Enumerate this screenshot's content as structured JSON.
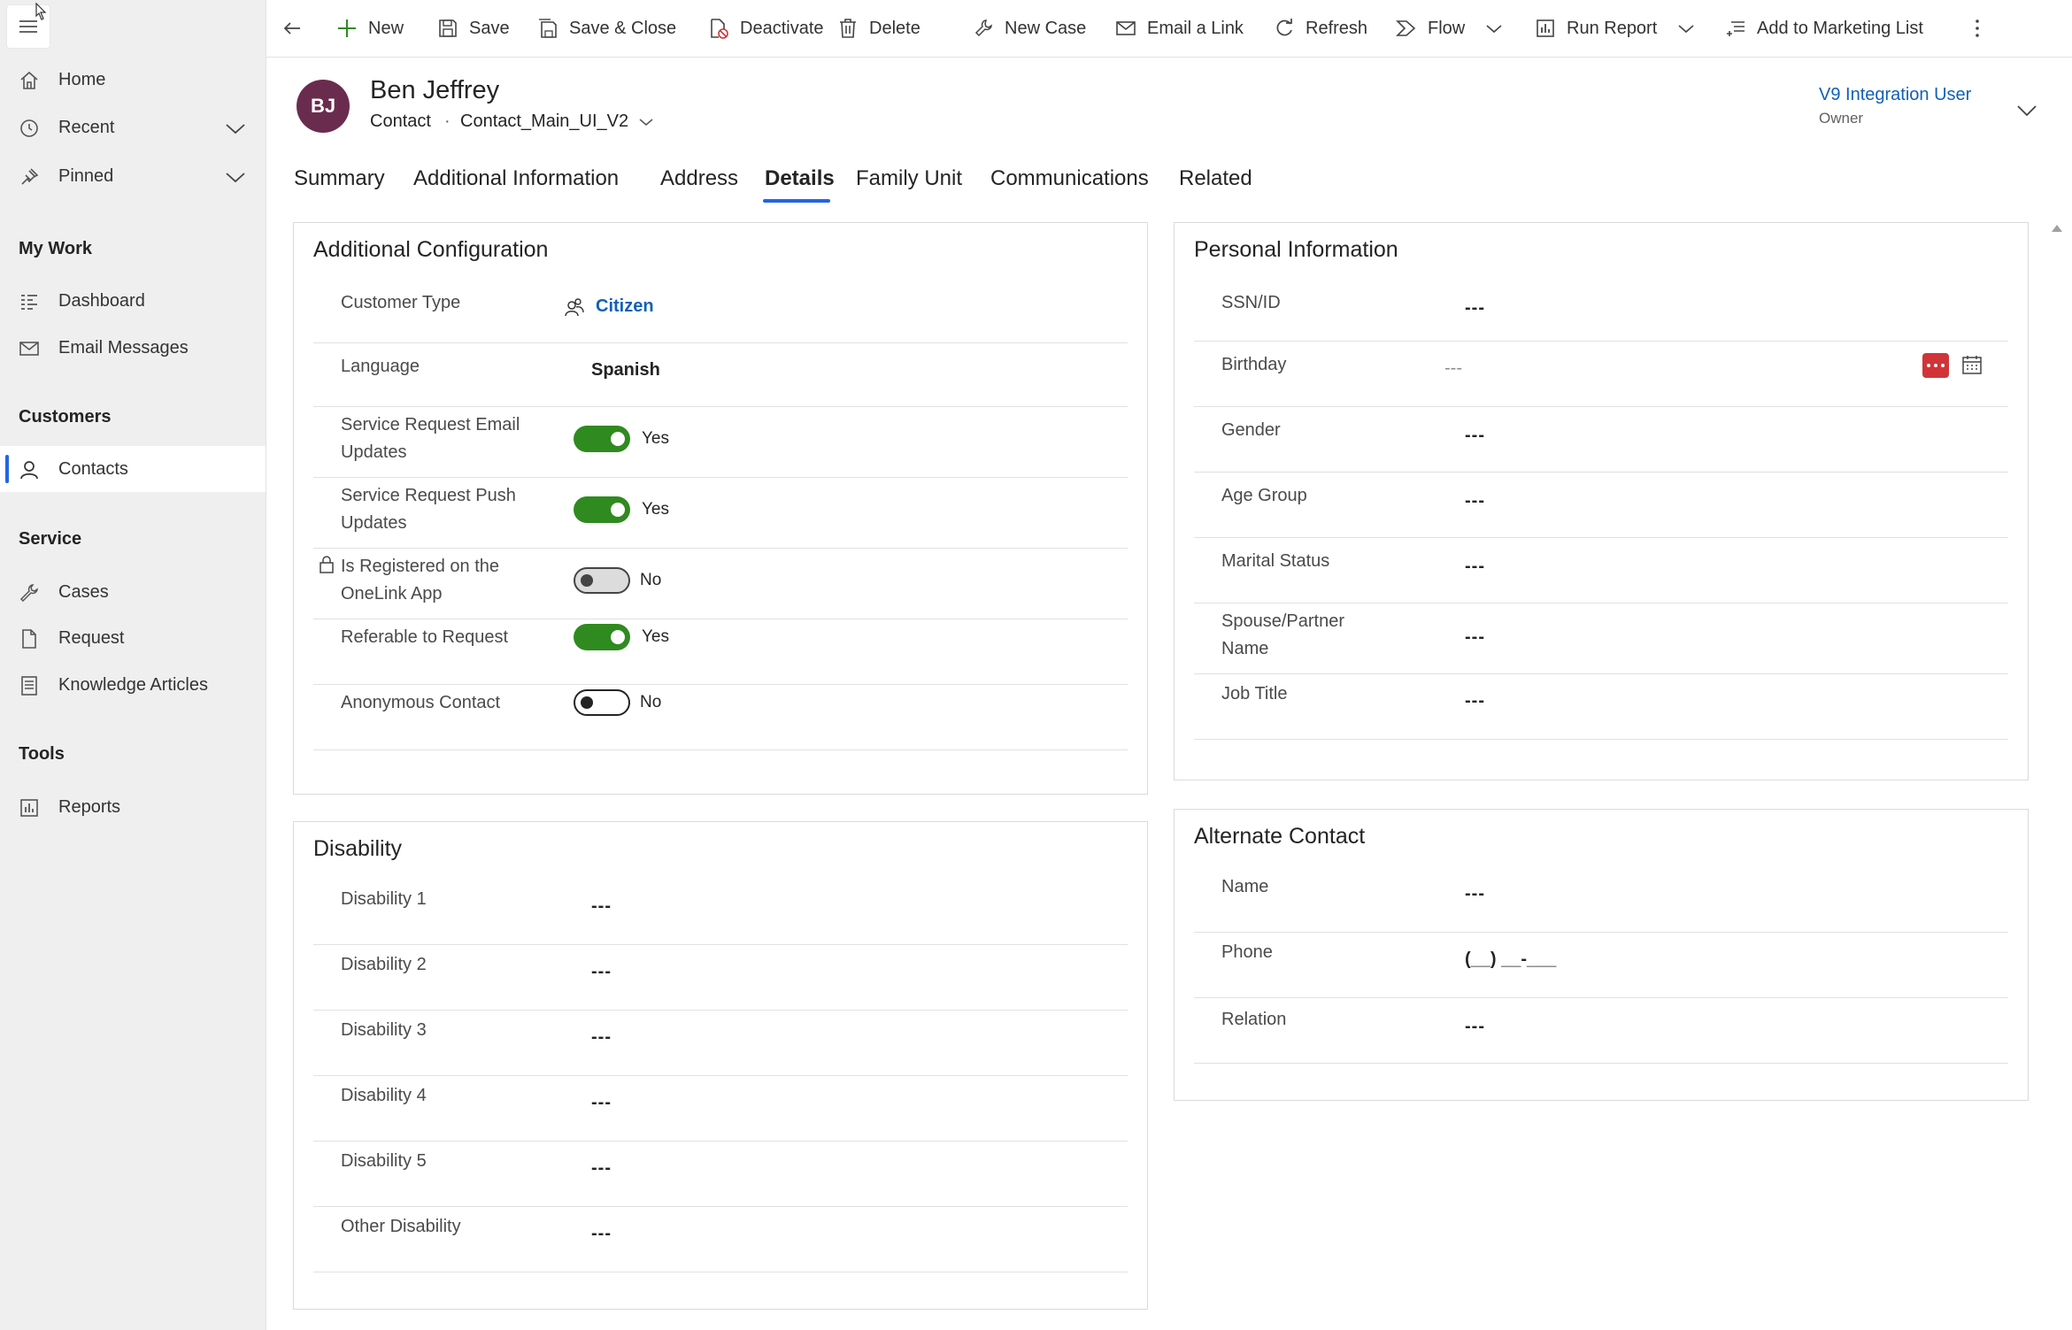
{
  "sidebar": {
    "items": [
      {
        "label": "Home",
        "icon": "home-icon"
      },
      {
        "label": "Recent",
        "icon": "clock-icon"
      },
      {
        "label": "Pinned",
        "icon": "pin-icon"
      },
      {
        "label": "Dashboard",
        "icon": "dashboard-icon"
      },
      {
        "label": "Email Messages",
        "icon": "mail-icon"
      },
      {
        "label": "Contacts",
        "icon": "person-icon"
      },
      {
        "label": "Cases",
        "icon": "wrench-icon"
      },
      {
        "label": "Request",
        "icon": "document-icon"
      },
      {
        "label": "Knowledge Articles",
        "icon": "book-icon"
      },
      {
        "label": "Reports",
        "icon": "report-icon"
      }
    ],
    "groups": [
      "My Work",
      "Customers",
      "Service",
      "Tools"
    ]
  },
  "commands": [
    {
      "label": "New",
      "icon": "plus-icon"
    },
    {
      "label": "Save",
      "icon": "save-icon"
    },
    {
      "label": "Save & Close",
      "icon": "save-close-icon"
    },
    {
      "label": "Deactivate",
      "icon": "deactivate-icon"
    },
    {
      "label": "Delete",
      "icon": "trash-icon"
    },
    {
      "label": "New Case",
      "icon": "new-case-icon"
    },
    {
      "label": "Email a Link",
      "icon": "email-link-icon"
    },
    {
      "label": "Refresh",
      "icon": "refresh-icon"
    },
    {
      "label": "Flow",
      "icon": "flow-icon"
    },
    {
      "label": "Run Report",
      "icon": "report-icon"
    },
    {
      "label": "Add to Marketing List",
      "icon": "add-list-icon"
    }
  ],
  "record": {
    "initials": "BJ",
    "name": "Ben Jeffrey",
    "entity": "Contact",
    "separator": "·",
    "form": "Contact_Main_UI_V2",
    "owner_name": "V9 Integration User",
    "owner_role": "Owner"
  },
  "tabs": [
    "Summary",
    "Additional Information",
    "Address",
    "Details",
    "Family Unit",
    "Communications",
    "Related"
  ],
  "active_tab": "Details",
  "sections": {
    "additional_configuration": {
      "title": "Additional Configuration",
      "customer_type_label": "Customer Type",
      "customer_type_value": "Citizen",
      "language_label": "Language",
      "language_value": "Spanish",
      "toggles": [
        {
          "label1": "Service Request Email",
          "label2": "Updates",
          "state": "Yes",
          "on": true
        },
        {
          "label1": "Service Request Push",
          "label2": "Updates",
          "state": "Yes",
          "on": true
        },
        {
          "label1": "Is Registered on the",
          "label2": "OneLink App",
          "state": "No",
          "on": false,
          "locked": true
        },
        {
          "label1": "Referable to Request",
          "label2": "",
          "state": "Yes",
          "on": true
        },
        {
          "label1": "Anonymous Contact",
          "label2": "",
          "state": "No",
          "on": false
        }
      ]
    },
    "disability": {
      "title": "Disability",
      "fields": [
        {
          "label": "Disability 1",
          "value": "---"
        },
        {
          "label": "Disability 2",
          "value": "---"
        },
        {
          "label": "Disability 3",
          "value": "---"
        },
        {
          "label": "Disability 4",
          "value": "---"
        },
        {
          "label": "Disability 5",
          "value": "---"
        },
        {
          "label": "Other Disability",
          "value": "---"
        }
      ]
    },
    "personal_information": {
      "title": "Personal Information",
      "ssn_label": "SSN/ID",
      "ssn_value": "---",
      "birthday_label": "Birthday",
      "birthday_value": "---",
      "gender_label": "Gender",
      "gender_value": "---",
      "age_group_label": "Age Group",
      "age_group_value": "---",
      "marital_label": "Marital Status",
      "marital_value": "---",
      "spouse_label1": "Spouse/Partner",
      "spouse_label2": "Name",
      "spouse_value": "---",
      "job_label": "Job Title",
      "job_value": "---"
    },
    "alternate_contact": {
      "title": "Alternate Contact",
      "name_label": "Name",
      "name_value": "---",
      "phone_label": "Phone",
      "phone_value": "(__) __-___",
      "relation_label": "Relation",
      "relation_value": "---"
    }
  },
  "colors": {
    "accent": "#2266e3",
    "toggle_on": "#2f8a1f",
    "avatar": "#6a2c4e",
    "link": "#1160b7",
    "danger": "#d13438"
  }
}
